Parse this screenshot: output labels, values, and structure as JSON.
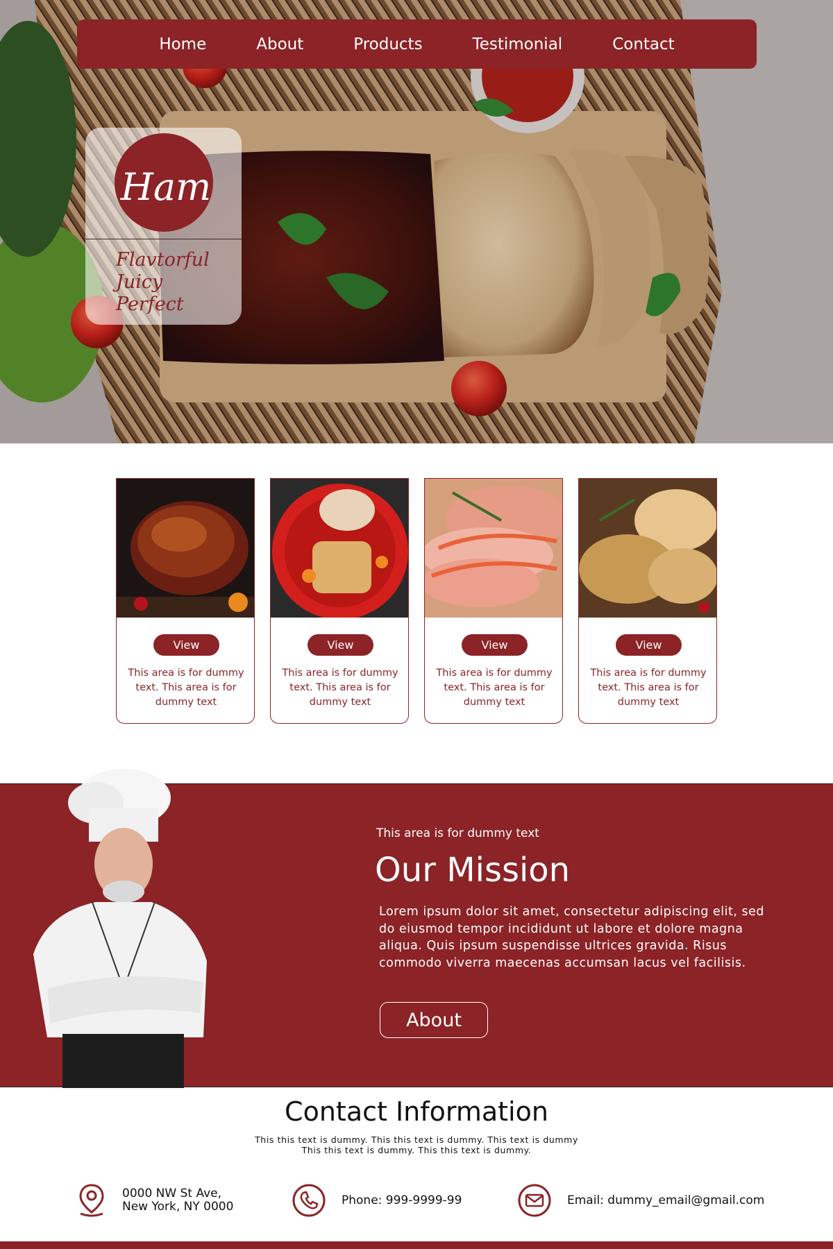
{
  "nav": {
    "items": [
      "Home",
      "About",
      "Products",
      "Testimonial",
      "Contact"
    ]
  },
  "hero": {
    "logo_text": "Ham",
    "tagline": [
      "Flavtorful",
      "Juicy",
      "Perfect"
    ]
  },
  "products": {
    "cards": [
      {
        "button": "View",
        "text": "This area is for dummy text. This area is for dummy text"
      },
      {
        "button": "View",
        "text": "This area is for dummy text. This area is for dummy text"
      },
      {
        "button": "View",
        "text": "This area is for dummy text. This area is for dummy text"
      },
      {
        "button": "View",
        "text": "This area is for dummy text. This area is for dummy text"
      }
    ]
  },
  "mission": {
    "kicker": "This area is for dummy text",
    "title": "Our Mission",
    "body": "Lorem ipsum dolor sit amet, consectetur adipiscing elit, sed do eiusmod tempor incididunt ut labore et dolore magna aliqua. Quis ipsum suspendisse ultrices gravida. Risus commodo viverra maecenas accumsan lacus vel facilisis.",
    "button": "About"
  },
  "contact": {
    "title": "Contact Information",
    "subtitle_line1": "This this text is dummy. This this text is dummy. This text is dummy",
    "subtitle_line2": "This this text is dummy. This this text is dummy.",
    "address_line1": "0000 NW St Ave,",
    "address_line2": "New York, NY 0000",
    "phone": "Phone: 999-9999-99",
    "email": "Email: dummy_email@gmail.com"
  },
  "colors": {
    "brand": "#8b2327",
    "white": "#ffffff"
  },
  "icons": [
    "location-pin-icon",
    "phone-icon",
    "mail-icon"
  ]
}
